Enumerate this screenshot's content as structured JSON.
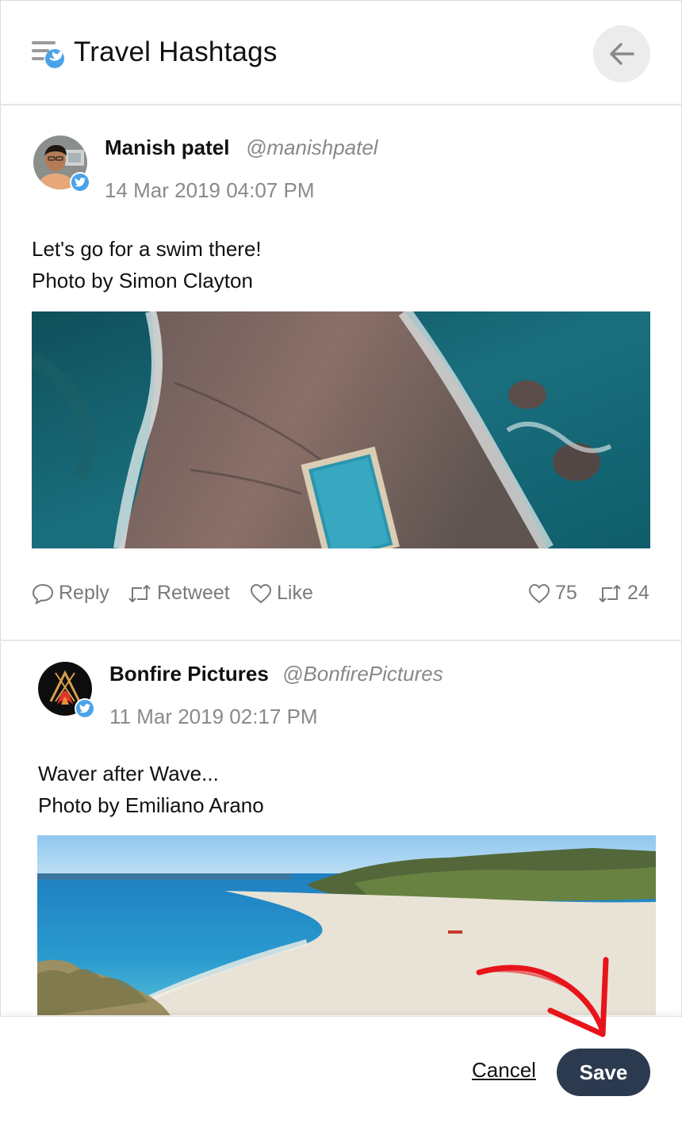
{
  "header": {
    "title": "Travel Hashtags",
    "icon": "twitter-feed-icon",
    "back_icon": "arrow-left-icon"
  },
  "tweets": [
    {
      "author": "Manish patel",
      "handle": "@manishpatel",
      "date": "14 Mar 2019 04:07 PM",
      "lines": [
        "Let's go for a swim there!",
        "Photo by Simon Clayton"
      ],
      "photo": "aerial-rock-pool-photo",
      "actions": {
        "reply": "Reply",
        "retweet": "Retweet",
        "like": "Like"
      },
      "likes": "75",
      "retweets": "24"
    },
    {
      "author": "Bonfire Pictures",
      "handle": "@BonfirePictures",
      "date": "11 Mar 2019 02:17 PM",
      "lines": [
        "Waver after Wave...",
        "Photo by Emiliano Arano"
      ],
      "photo": "beach-coastline-photo"
    }
  ],
  "footer": {
    "cancel_label": "Cancel",
    "save_label": "Save"
  },
  "colors": {
    "twitter_blue": "#4aa3e8",
    "save_button": "#2c3a4f",
    "annotation_arrow": "#e8141b"
  }
}
